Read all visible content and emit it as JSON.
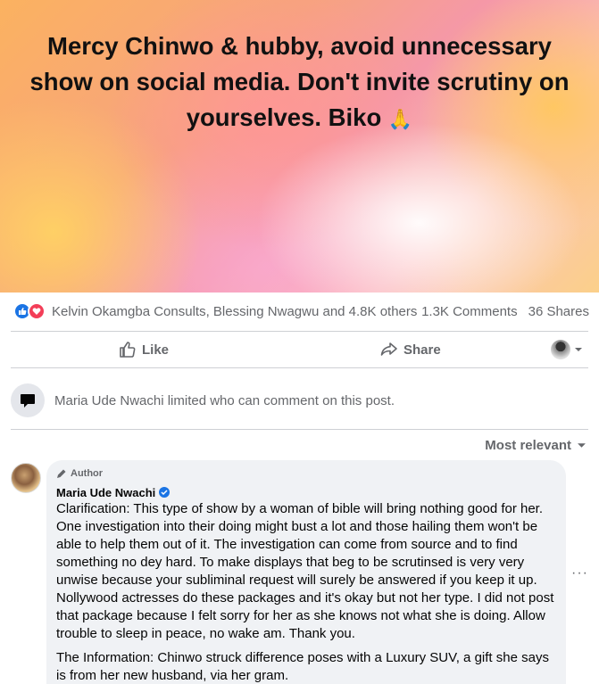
{
  "post": {
    "text": "Mercy Chinwo & hubby, avoid unnecessary show on social media. Don't invite scrutiny on yourselves. Biko",
    "emoji": "🙏"
  },
  "reactions": {
    "names": "Kelvin Okamgba Consults, Blessing Nwagwu and 4.8K others",
    "comments": "1.3K Comments",
    "shares": "36 Shares"
  },
  "actions": {
    "like": "Like",
    "share": "Share"
  },
  "comment_limit": {
    "text": "Maria Ude Nwachi limited who can comment on this post."
  },
  "sort": {
    "label": "Most relevant"
  },
  "comment": {
    "tag": "Author",
    "name": "Maria Ude Nwachi",
    "paragraph1": "Clarification: This type of show by a woman of bible will bring nothing good for her. One investigation into their doing might bust a lot and those hailing them won't be able to help them out of it. The investigation can come from source and to find something no dey hard. To make displays that beg to be scrutinsed is very very unwise because your subliminal request will surely be answered if you keep it up. Nollywood actresses do these packages and it's okay but not her type. I did not post that package because I felt sorry for her as she knows not what she is doing. Allow trouble to sleep in peace, no wake am. Thank you.",
    "paragraph2": "The Information: Chinwo struck difference poses with a Luxury SUV, a gift she says is from her new husband, via her gram.",
    "more": "···"
  },
  "colors": {
    "accent": "#1b74e4",
    "love": "#f33e58",
    "muted_text": "#65676b",
    "bubble_bg": "#f0f2f5"
  },
  "icons": [
    "like-reaction-icon",
    "love-reaction-icon",
    "thumbs-up-icon",
    "share-arrow-icon",
    "chevron-down-icon",
    "speech-bubble-icon",
    "pencil-icon",
    "verified-badge-icon",
    "more-options-icon"
  ]
}
